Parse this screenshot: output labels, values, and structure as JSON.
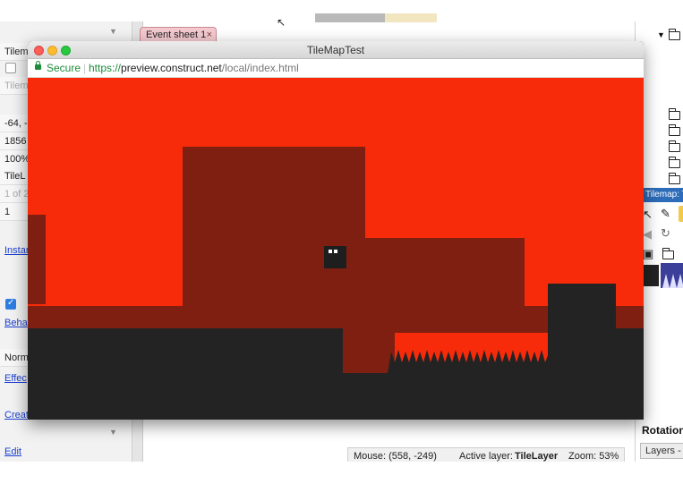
{
  "colors": {
    "sky": "#f72b0a",
    "background_blocks": "#7f1f12",
    "ground": "#232323",
    "player": "#1e1e1e",
    "player_eyes": "#ffffff",
    "secure_green": "#1d8c3a"
  },
  "editor": {
    "event_sheet_tab": "Event sheet 1",
    "tab_close": "×",
    "left_panel": {
      "rows": [
        "Tilem",
        "",
        "Tilem",
        "-64, -",
        "1856",
        "100%",
        "TileL",
        "1 of 2",
        "1",
        "Norm"
      ],
      "links": [
        "Instan",
        "Beha",
        "Effec",
        "Creat",
        "Edit"
      ]
    },
    "right_panel": {
      "tilemap_bar": "Tilemap: T",
      "rotation_label": "Rotation",
      "layers_tab": "Layers - |"
    },
    "status": {
      "mouse": "Mouse: (558, -249)",
      "active_layer_label": "Active layer: ",
      "active_layer_value": "TileLayer",
      "zoom": "Zoom: 53%"
    }
  },
  "preview_window": {
    "title": "TileMapTest",
    "secure_label": "Secure",
    "url_protocol": "https://",
    "url_host": "preview.construct.net",
    "url_path": "/local/index.html"
  },
  "icons": [
    "lock-icon",
    "folder-icon",
    "pencil-icon",
    "pointer-icon",
    "rotate-icon",
    "save-icon",
    "mirror-icon",
    "chevron-down-icon"
  ]
}
